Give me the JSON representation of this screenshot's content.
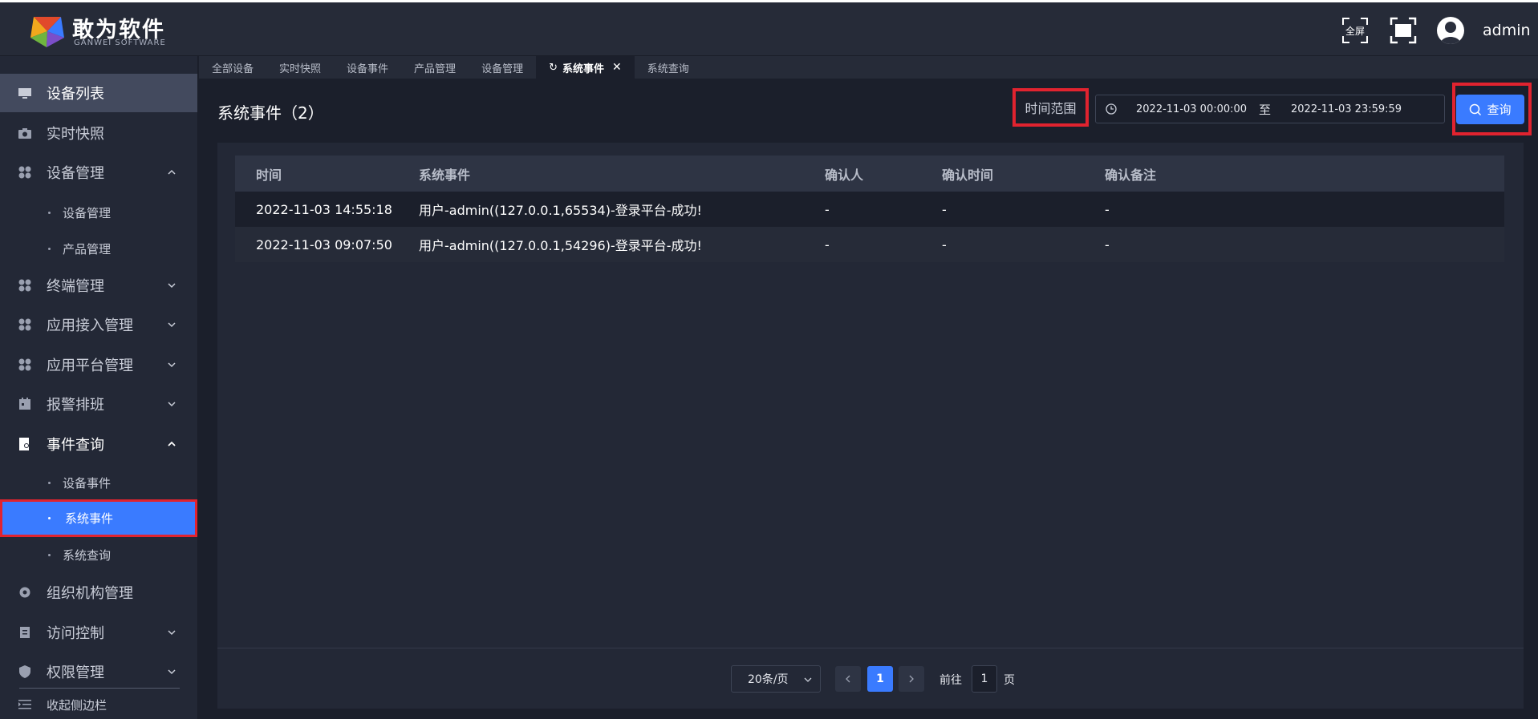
{
  "header": {
    "brand_cn": "敢为软件",
    "brand_en": "GANWEI SOFTWARE",
    "fullscreen_label": "全屏",
    "username": "admin"
  },
  "sidebar": {
    "items": [
      {
        "label": "设备列表",
        "icon": "monitor-icon",
        "active": true
      },
      {
        "label": "实时快照",
        "icon": "camera-icon"
      },
      {
        "label": "设备管理",
        "icon": "grid-icon",
        "expanded": true
      },
      {
        "label": "设备管理",
        "sub": true
      },
      {
        "label": "产品管理",
        "sub": true
      },
      {
        "label": "终端管理",
        "icon": "grid-icon"
      },
      {
        "label": "应用接入管理",
        "icon": "grid-icon"
      },
      {
        "label": "应用平台管理",
        "icon": "grid-icon"
      },
      {
        "label": "报警排班",
        "icon": "calendar-icon"
      },
      {
        "label": "事件查询",
        "icon": "document-search-icon",
        "expanded": true
      },
      {
        "label": "设备事件",
        "sub": true
      },
      {
        "label": "系统事件",
        "sub": true,
        "selected": true
      },
      {
        "label": "系统查询",
        "sub": true
      },
      {
        "label": "组织机构管理",
        "icon": "gear-icon"
      },
      {
        "label": "访问控制",
        "icon": "document-icon"
      },
      {
        "label": "权限管理",
        "icon": "shield-icon"
      }
    ],
    "collapse_label": "收起侧边栏"
  },
  "tabs": [
    {
      "label": "全部设备"
    },
    {
      "label": "实时快照"
    },
    {
      "label": "设备事件"
    },
    {
      "label": "产品管理"
    },
    {
      "label": "设备管理"
    },
    {
      "label": "系统事件",
      "active": true
    },
    {
      "label": "系统查询"
    }
  ],
  "main": {
    "title": "系统事件（2）",
    "range_label": "时间范围",
    "range_start": "2022-11-03 00:00:00",
    "range_sep": "至",
    "range_end": "2022-11-03 23:59:59",
    "query_label": "查询"
  },
  "table": {
    "columns": [
      "时间",
      "系统事件",
      "确认人",
      "确认时间",
      "确认备注"
    ],
    "rows": [
      [
        "2022-11-03 14:55:18",
        "用户-admin((127.0.0.1,65534)-登录平台-成功!",
        "-",
        "-",
        "-"
      ],
      [
        "2022-11-03 09:07:50",
        "用户-admin((127.0.0.1,54296)-登录平台-成功!",
        "-",
        "-",
        "-"
      ]
    ]
  },
  "pager": {
    "page_size": "20条/页",
    "current": "1",
    "goto_label": "前往",
    "goto_value": "1",
    "goto_suffix": "页"
  },
  "colors": {
    "accent": "#3a7bff",
    "highlight": "#e1232f"
  }
}
